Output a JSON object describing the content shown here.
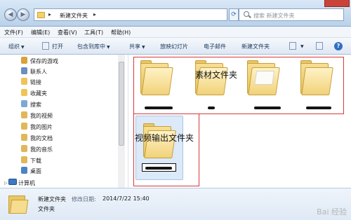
{
  "window": {
    "address_path": "新建文件夹",
    "search_placeholder": "搜索 新建文件夹"
  },
  "menu": [
    "文件(F)",
    "编辑(E)",
    "查看(V)",
    "工具(T)",
    "帮助(H)"
  ],
  "toolbar": {
    "organize": "组织",
    "open": "打开",
    "include_in_library": "包含到库中",
    "share": "共享",
    "slideshow": "放映幻灯片",
    "email": "电子邮件",
    "new_folder": "新建文件夹"
  },
  "nav": {
    "items": [
      {
        "label": "保存的游戏",
        "icon": "saved-games-icon",
        "color": "#d8a33b"
      },
      {
        "label": "联系人",
        "icon": "contacts-icon",
        "color": "#6a8fc0"
      },
      {
        "label": "链接",
        "icon": "links-icon",
        "color": "#f0c35a"
      },
      {
        "label": "收藏夹",
        "icon": "favorites-icon",
        "color": "#f0c35a"
      },
      {
        "label": "搜索",
        "icon": "search-folder-icon",
        "color": "#7da7d8"
      },
      {
        "label": "我的视频",
        "icon": "videos-icon",
        "color": "#e0b85a"
      },
      {
        "label": "我的图片",
        "icon": "pictures-icon",
        "color": "#e0b85a"
      },
      {
        "label": "我的文档",
        "icon": "documents-icon",
        "color": "#e0b85a"
      },
      {
        "label": "我的音乐",
        "icon": "music-icon",
        "color": "#e0b85a"
      },
      {
        "label": "下载",
        "icon": "downloads-icon",
        "color": "#e0b85a"
      },
      {
        "label": "桌面",
        "icon": "desktop-icon",
        "color": "#4c83c6"
      }
    ],
    "computer": "计算机"
  },
  "content": {
    "annotation_top": "素材文件夹",
    "annotation_bottom": "视频输出文件夹"
  },
  "status": {
    "name": "新建文件夹",
    "modified_label": "修改日期:",
    "modified_date": "2014/7/22 15:40",
    "type": "文件夹"
  },
  "watermark": "Bai 经验"
}
